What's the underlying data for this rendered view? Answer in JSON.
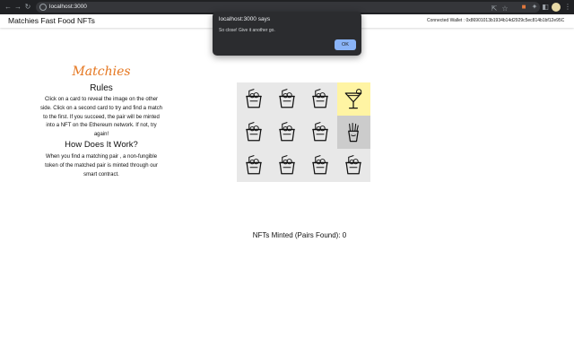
{
  "browser": {
    "url": "localhost:3000",
    "icons": [
      "back-arrow-icon",
      "forward-arrow-icon",
      "reload-icon",
      "info-icon",
      "share-icon",
      "star-icon",
      "extension-icon",
      "puzzle-icon",
      "sidebar-icon",
      "kebab-menu-icon"
    ]
  },
  "navbar": {
    "brand": "Matchies Fast Food NFTs",
    "wallet": "Connected Wallet : 0x86901013b1934b14d2929c5ec814b1bf12e95C"
  },
  "left": {
    "logo": "Matchies",
    "rules_title": "Rules",
    "rules_text": "Click on a card to reveal the image on the other side. Click on a second card to try and find a match to the first. If you succeed, the pair will be minted into a NFT on the Ethereum network. If not, try again!",
    "how_title": "How Does It Work?",
    "how_text": "When you find a matching pair , a non-fungible token of the matched pair is minted through our smart contract."
  },
  "grid": {
    "cards": [
      {
        "icon": "takeaway-box-icon",
        "state": "hidden"
      },
      {
        "icon": "takeaway-box-icon",
        "state": "hidden"
      },
      {
        "icon": "takeaway-box-icon",
        "state": "hidden"
      },
      {
        "icon": "cocktail-icon",
        "state": "revealed"
      },
      {
        "icon": "takeaway-box-icon",
        "state": "hidden"
      },
      {
        "icon": "takeaway-box-icon",
        "state": "hidden"
      },
      {
        "icon": "takeaway-box-icon",
        "state": "hidden"
      },
      {
        "icon": "fries-icon",
        "state": "revealed"
      },
      {
        "icon": "takeaway-box-icon",
        "state": "hidden"
      },
      {
        "icon": "takeaway-box-icon",
        "state": "hidden"
      },
      {
        "icon": "takeaway-box-icon",
        "state": "hidden"
      },
      {
        "icon": "takeaway-box-icon",
        "state": "hidden"
      }
    ],
    "colors": {
      "hidden": "#e8e8e8",
      "revealed_yellow": "#fff4a3",
      "revealed_gray": "#cccccc"
    }
  },
  "status": {
    "minted": "NFTs Minted (Pairs Found): 0"
  },
  "dialog": {
    "title": "localhost:3000 says",
    "message": "So close! Give it another go.",
    "ok_label": "OK"
  }
}
